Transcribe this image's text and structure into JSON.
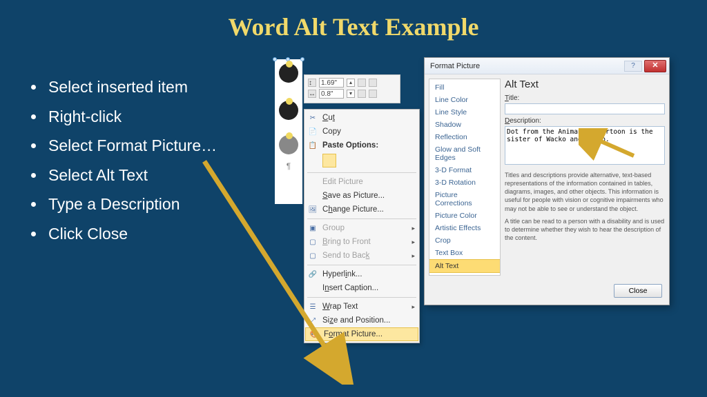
{
  "title": "Word Alt Text Example",
  "bullets": [
    "Select inserted item",
    "Right-click",
    "Select Format Picture…",
    "Select Alt Text",
    "Type a Description",
    "Click Close"
  ],
  "size_flyout": {
    "height": "1.69\"",
    "width": "0.8\""
  },
  "context_menu": {
    "cut": "Cut",
    "copy": "Copy",
    "paste_options": "Paste Options:",
    "edit_picture": "Edit Picture",
    "save_as": "Save as Picture...",
    "change_picture": "Change Picture...",
    "group": "Group",
    "bring_front": "Bring to Front",
    "send_back": "Send to Back",
    "hyperlink": "Hyperlink...",
    "insert_caption": "Insert Caption...",
    "wrap_text": "Wrap Text",
    "size_position": "Size and Position...",
    "format_picture": "Format Picture..."
  },
  "dialog": {
    "title": "Format Picture",
    "categories": [
      "Fill",
      "Line Color",
      "Line Style",
      "Shadow",
      "Reflection",
      "Glow and Soft Edges",
      "3-D Format",
      "3-D Rotation",
      "Picture Corrections",
      "Picture Color",
      "Artistic Effects",
      "Crop",
      "Text Box",
      "Alt Text"
    ],
    "pane": {
      "heading": "Alt Text",
      "title_label": "Title:",
      "title_value": "",
      "desc_label": "Description:",
      "desc_value": "Dot from the Animaniac cartoon is the sister of Wacko and Yacko.",
      "help1": "Titles and descriptions provide alternative, text-based representations of the information contained in tables, diagrams, images, and other objects. This information is useful for people with vision or cognitive impairments who may not be able to see or understand the object.",
      "help2": "A title can be read to a person with a disability and is used to determine whether they wish to hear the description of the content."
    },
    "close_label": "Close"
  }
}
